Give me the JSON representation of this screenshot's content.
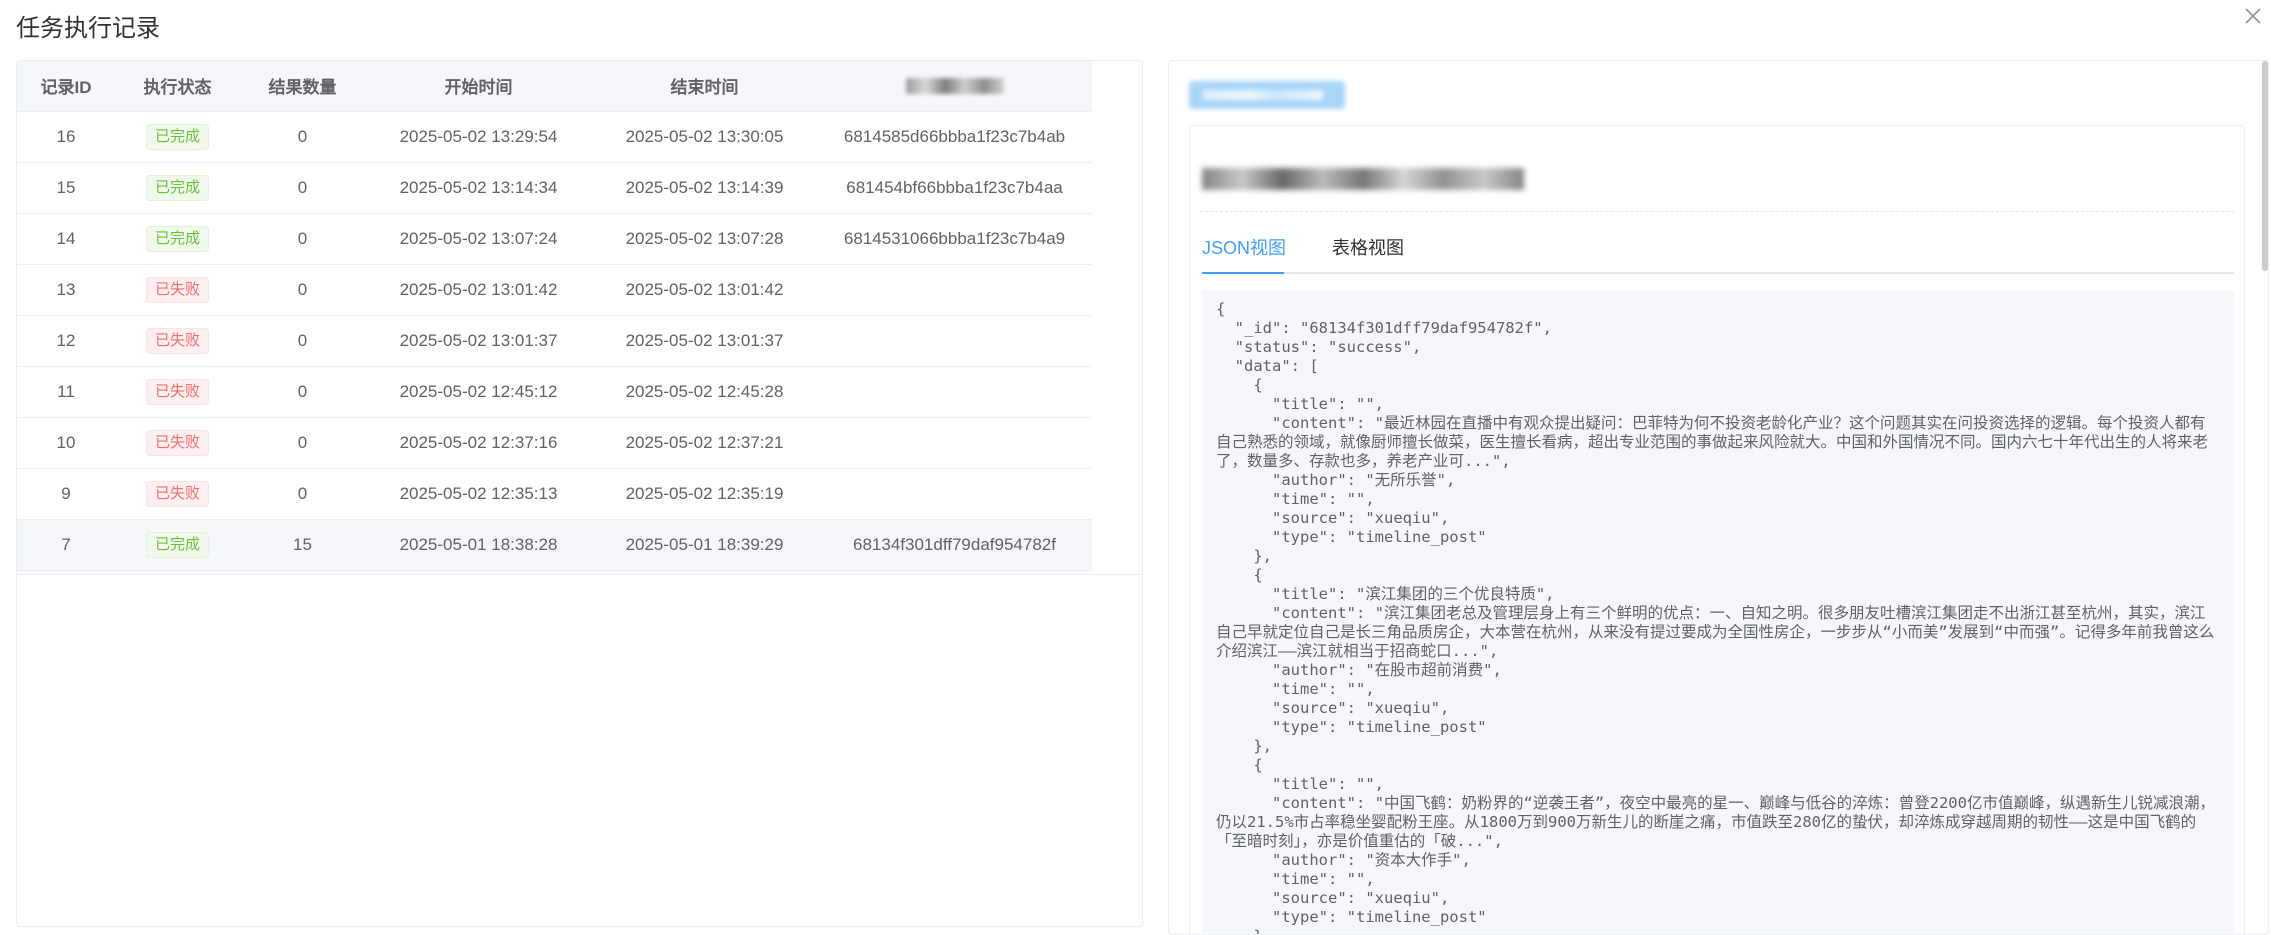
{
  "dialog": {
    "title": "任务执行记录",
    "close_icon": "close-icon"
  },
  "table": {
    "headers": [
      "记录ID",
      "执行状态",
      "结果数量",
      "开始时间",
      "结束时间"
    ],
    "rows": [
      {
        "id": "16",
        "status": "已完成",
        "status_type": "success",
        "count": "0",
        "start": "2025-05-02 13:29:54",
        "end": "2025-05-02 13:30:05",
        "doc_id": "6814585d66bbba1f23c7b4ab"
      },
      {
        "id": "15",
        "status": "已完成",
        "status_type": "success",
        "count": "0",
        "start": "2025-05-02 13:14:34",
        "end": "2025-05-02 13:14:39",
        "doc_id": "681454bf66bbba1f23c7b4aa"
      },
      {
        "id": "14",
        "status": "已完成",
        "status_type": "success",
        "count": "0",
        "start": "2025-05-02 13:07:24",
        "end": "2025-05-02 13:07:28",
        "doc_id": "6814531066bbba1f23c7b4a9"
      },
      {
        "id": "13",
        "status": "已失败",
        "status_type": "fail",
        "count": "0",
        "start": "2025-05-02 13:01:42",
        "end": "2025-05-02 13:01:42",
        "doc_id": ""
      },
      {
        "id": "12",
        "status": "已失败",
        "status_type": "fail",
        "count": "0",
        "start": "2025-05-02 13:01:37",
        "end": "2025-05-02 13:01:37",
        "doc_id": ""
      },
      {
        "id": "11",
        "status": "已失败",
        "status_type": "fail",
        "count": "0",
        "start": "2025-05-02 12:45:12",
        "end": "2025-05-02 12:45:28",
        "doc_id": ""
      },
      {
        "id": "10",
        "status": "已失败",
        "status_type": "fail",
        "count": "0",
        "start": "2025-05-02 12:37:16",
        "end": "2025-05-02 12:37:21",
        "doc_id": ""
      },
      {
        "id": "9",
        "status": "已失败",
        "status_type": "fail",
        "count": "0",
        "start": "2025-05-02 12:35:13",
        "end": "2025-05-02 12:35:19",
        "doc_id": ""
      },
      {
        "id": "7",
        "status": "已完成",
        "status_type": "success",
        "count": "15",
        "start": "2025-05-01 18:38:28",
        "end": "2025-05-01 18:39:29",
        "doc_id": "68134f301dff79daf954782f",
        "selected": true
      }
    ]
  },
  "detail": {
    "tabs": [
      "JSON视图",
      "表格视图"
    ],
    "active_tab": 0,
    "json_text": "{\n  \"_id\": \"68134f301dff79daf954782f\",\n  \"status\": \"success\",\n  \"data\": [\n    {\n      \"title\": \"\",\n      \"content\": \"最近林园在直播中有观众提出疑问：巴菲特为何不投资老龄化产业？这个问题其实在问投资选择的逻辑。每个投资人都有自己熟悉的领域，就像厨师擅长做菜，医生擅长看病，超出专业范围的事做起来风险就大。中国和外国情况不同。国内六七十年代出生的人将来老了，数量多、存款也多，养老产业可...\",\n      \"author\": \"无所乐誉\",\n      \"time\": \"\",\n      \"source\": \"xueqiu\",\n      \"type\": \"timeline_post\"\n    },\n    {\n      \"title\": \"滨江集团的三个优良特质\",\n      \"content\": \"滨江集团老总及管理层身上有三个鲜明的优点：一、自知之明。很多朋友吐槽滨江集团走不出浙江甚至杭州，其实，滨江自己早就定位自己是长三角品质房企，大本营在杭州，从来没有提过要成为全国性房企，一步步从“小而美”发展到“中而强”。记得多年前我曾这么介绍滨江——滨江就相当于招商蛇口...\",\n      \"author\": \"在股市超前消费\",\n      \"time\": \"\",\n      \"source\": \"xueqiu\",\n      \"type\": \"timeline_post\"\n    },\n    {\n      \"title\": \"\",\n      \"content\": \"中国飞鹤：奶粉界的“逆袭王者”，夜空中最亮的星一、巅峰与低谷的淬炼：曾登2200亿市值巅峰，纵遇新生儿锐减浪潮，仍以21.5%市占率稳坐婴配粉王座。从1800万到900万新生儿的断崖之痛，市值跌至280亿的蛰伏，却淬炼成穿越周期的韧性——这是中国飞鹤的「至暗时刻」，亦是价值重估的「破...\",\n      \"author\": \"资本大作手\",\n      \"time\": \"\",\n      \"source\": \"xueqiu\",\n      \"type\": \"timeline_post\"\n    },"
  },
  "colors": {
    "primary": "#409eff",
    "success": "#67c23a",
    "danger": "#f56c6c",
    "border": "#ebeef5",
    "header_bg": "#f5f7fa"
  }
}
